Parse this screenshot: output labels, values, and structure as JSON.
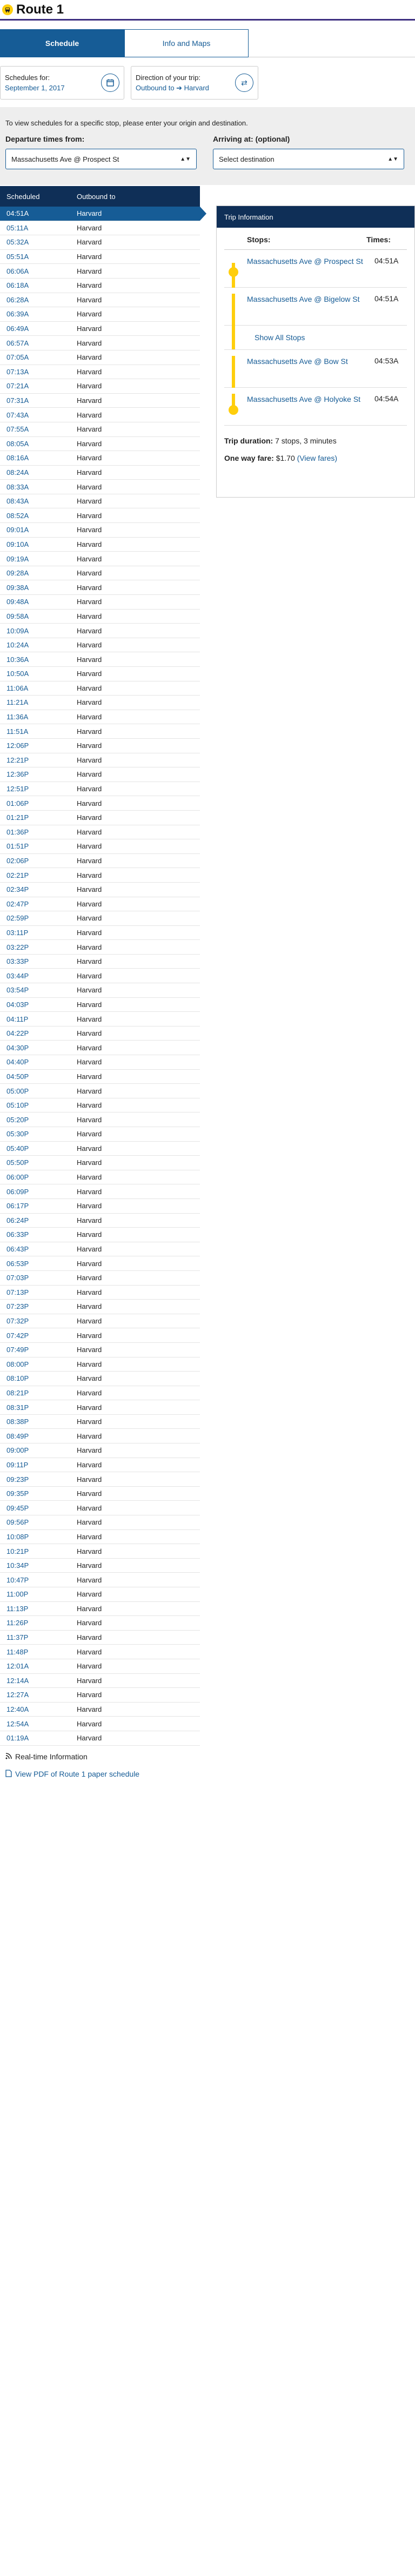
{
  "header": {
    "title": "Route 1"
  },
  "tabs": [
    {
      "label": "Schedule"
    },
    {
      "label": "Info and Maps"
    }
  ],
  "schedules_for": {
    "label": "Schedules for:",
    "value": "September 1, 2017"
  },
  "direction": {
    "label": "Direction of your trip:",
    "value": "Outbound to ➔ Harvard"
  },
  "filter": {
    "instruction": "To view schedules for a specific stop, please enter your origin and destination.",
    "from_label": "Departure times from:",
    "from_value": "Massachusetts Ave @ Prospect St",
    "to_label": "Arriving at: (optional)",
    "to_value": "Select destination"
  },
  "schedule": {
    "col_scheduled": "Scheduled",
    "col_outbound": "Outbound to",
    "rows": [
      [
        "04:51A",
        "Harvard"
      ],
      [
        "05:11A",
        "Harvard"
      ],
      [
        "05:32A",
        "Harvard"
      ],
      [
        "05:51A",
        "Harvard"
      ],
      [
        "06:06A",
        "Harvard"
      ],
      [
        "06:18A",
        "Harvard"
      ],
      [
        "06:28A",
        "Harvard"
      ],
      [
        "06:39A",
        "Harvard"
      ],
      [
        "06:49A",
        "Harvard"
      ],
      [
        "06:57A",
        "Harvard"
      ],
      [
        "07:05A",
        "Harvard"
      ],
      [
        "07:13A",
        "Harvard"
      ],
      [
        "07:21A",
        "Harvard"
      ],
      [
        "07:31A",
        "Harvard"
      ],
      [
        "07:43A",
        "Harvard"
      ],
      [
        "07:55A",
        "Harvard"
      ],
      [
        "08:05A",
        "Harvard"
      ],
      [
        "08:16A",
        "Harvard"
      ],
      [
        "08:24A",
        "Harvard"
      ],
      [
        "08:33A",
        "Harvard"
      ],
      [
        "08:43A",
        "Harvard"
      ],
      [
        "08:52A",
        "Harvard"
      ],
      [
        "09:01A",
        "Harvard"
      ],
      [
        "09:10A",
        "Harvard"
      ],
      [
        "09:19A",
        "Harvard"
      ],
      [
        "09:28A",
        "Harvard"
      ],
      [
        "09:38A",
        "Harvard"
      ],
      [
        "09:48A",
        "Harvard"
      ],
      [
        "09:58A",
        "Harvard"
      ],
      [
        "10:09A",
        "Harvard"
      ],
      [
        "10:24A",
        "Harvard"
      ],
      [
        "10:36A",
        "Harvard"
      ],
      [
        "10:50A",
        "Harvard"
      ],
      [
        "11:06A",
        "Harvard"
      ],
      [
        "11:21A",
        "Harvard"
      ],
      [
        "11:36A",
        "Harvard"
      ],
      [
        "11:51A",
        "Harvard"
      ],
      [
        "12:06P",
        "Harvard"
      ],
      [
        "12:21P",
        "Harvard"
      ],
      [
        "12:36P",
        "Harvard"
      ],
      [
        "12:51P",
        "Harvard"
      ],
      [
        "01:06P",
        "Harvard"
      ],
      [
        "01:21P",
        "Harvard"
      ],
      [
        "01:36P",
        "Harvard"
      ],
      [
        "01:51P",
        "Harvard"
      ],
      [
        "02:06P",
        "Harvard"
      ],
      [
        "02:21P",
        "Harvard"
      ],
      [
        "02:34P",
        "Harvard"
      ],
      [
        "02:47P",
        "Harvard"
      ],
      [
        "02:59P",
        "Harvard"
      ],
      [
        "03:11P",
        "Harvard"
      ],
      [
        "03:22P",
        "Harvard"
      ],
      [
        "03:33P",
        "Harvard"
      ],
      [
        "03:44P",
        "Harvard"
      ],
      [
        "03:54P",
        "Harvard"
      ],
      [
        "04:03P",
        "Harvard"
      ],
      [
        "04:11P",
        "Harvard"
      ],
      [
        "04:22P",
        "Harvard"
      ],
      [
        "04:30P",
        "Harvard"
      ],
      [
        "04:40P",
        "Harvard"
      ],
      [
        "04:50P",
        "Harvard"
      ],
      [
        "05:00P",
        "Harvard"
      ],
      [
        "05:10P",
        "Harvard"
      ],
      [
        "05:20P",
        "Harvard"
      ],
      [
        "05:30P",
        "Harvard"
      ],
      [
        "05:40P",
        "Harvard"
      ],
      [
        "05:50P",
        "Harvard"
      ],
      [
        "06:00P",
        "Harvard"
      ],
      [
        "06:09P",
        "Harvard"
      ],
      [
        "06:17P",
        "Harvard"
      ],
      [
        "06:24P",
        "Harvard"
      ],
      [
        "06:33P",
        "Harvard"
      ],
      [
        "06:43P",
        "Harvard"
      ],
      [
        "06:53P",
        "Harvard"
      ],
      [
        "07:03P",
        "Harvard"
      ],
      [
        "07:13P",
        "Harvard"
      ],
      [
        "07:23P",
        "Harvard"
      ],
      [
        "07:32P",
        "Harvard"
      ],
      [
        "07:42P",
        "Harvard"
      ],
      [
        "07:49P",
        "Harvard"
      ],
      [
        "08:00P",
        "Harvard"
      ],
      [
        "08:10P",
        "Harvard"
      ],
      [
        "08:21P",
        "Harvard"
      ],
      [
        "08:31P",
        "Harvard"
      ],
      [
        "08:38P",
        "Harvard"
      ],
      [
        "08:49P",
        "Harvard"
      ],
      [
        "09:00P",
        "Harvard"
      ],
      [
        "09:11P",
        "Harvard"
      ],
      [
        "09:23P",
        "Harvard"
      ],
      [
        "09:35P",
        "Harvard"
      ],
      [
        "09:45P",
        "Harvard"
      ],
      [
        "09:56P",
        "Harvard"
      ],
      [
        "10:08P",
        "Harvard"
      ],
      [
        "10:21P",
        "Harvard"
      ],
      [
        "10:34P",
        "Harvard"
      ],
      [
        "10:47P",
        "Harvard"
      ],
      [
        "11:00P",
        "Harvard"
      ],
      [
        "11:13P",
        "Harvard"
      ],
      [
        "11:26P",
        "Harvard"
      ],
      [
        "11:37P",
        "Harvard"
      ],
      [
        "11:48P",
        "Harvard"
      ],
      [
        "12:01A",
        "Harvard"
      ],
      [
        "12:14A",
        "Harvard"
      ],
      [
        "12:27A",
        "Harvard"
      ],
      [
        "12:40A",
        "Harvard"
      ],
      [
        "12:54A",
        "Harvard"
      ],
      [
        "01:19A",
        "Harvard"
      ]
    ]
  },
  "trip": {
    "header": "Trip Information",
    "col_stops": "Stops:",
    "col_times": "Times:",
    "stops": [
      {
        "name": "Massachusetts Ave @ Prospect St",
        "time": "04:51A"
      },
      {
        "name": "Massachusetts Ave @ Bigelow St",
        "time": "04:51A"
      },
      {
        "name": "Massachusetts Ave @ Bow St",
        "time": "04:53A"
      },
      {
        "name": "Massachusetts Ave @ Holyoke St",
        "time": "04:54A"
      }
    ],
    "show_all": "Show All Stops",
    "duration_label": "Trip duration:",
    "duration_value": "7 stops, 3 minutes",
    "fare_label": "One way fare:",
    "fare_value": "$1.70",
    "fare_link": "(View fares)"
  },
  "footer": {
    "realtime": "Real-time Information",
    "pdf": "View PDF of Route 1 paper schedule"
  },
  "colors": {
    "brand": "#165c96",
    "navy": "#0f2f57",
    "bus_yellow": "#ffce0c",
    "title_rule": "#3d2f80"
  }
}
